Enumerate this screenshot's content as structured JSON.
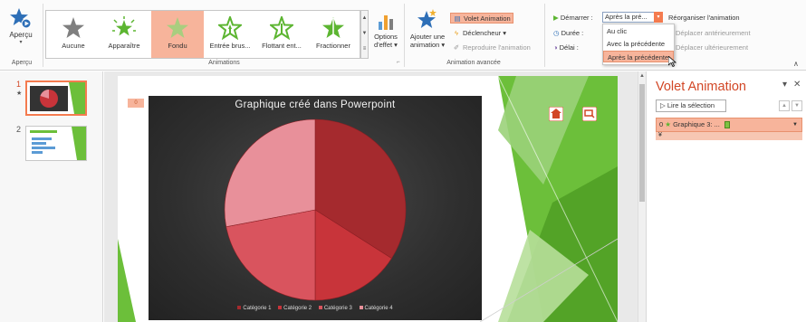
{
  "ribbon": {
    "apercu_button": "Aperçu",
    "apercu_group": "Aperçu",
    "animations_group": "Animations",
    "advanced_group": "Animation avancée",
    "effects": [
      {
        "label": "Aucune",
        "color": "#7f7f7f"
      },
      {
        "label": "Apparaître",
        "color": "#5cb531"
      },
      {
        "label": "Fondu",
        "color": "#5cb531"
      },
      {
        "label": "Entrée brus...",
        "color": "#5cb531"
      },
      {
        "label": "Flottant ent...",
        "color": "#5cb531"
      },
      {
        "label": "Fractionner",
        "color": "#5cb531"
      }
    ],
    "selected_effect": "Fondu",
    "options_label_1": "Options",
    "options_label_2": "d'effet ▾",
    "add_anim_1": "Ajouter une",
    "add_anim_2": "animation ▾",
    "volet_animation": "Volet Animation",
    "declencheur": "Déclencheur ▾",
    "reproduire": "Reproduire l'animation",
    "demarrer_label": "Démarrer :",
    "demarrer_value": "Après la pré...",
    "duree_label": "Durée :",
    "delai_label": "Délai :",
    "dropdown_options": [
      "Au clic",
      "Avec la précédente",
      "Après la précédente"
    ],
    "dropdown_selected": "Après la précédente",
    "reorganiser": "Réorganiser l'animation",
    "deplacer_avant": "Déplacer antérieurement",
    "deplacer_apres": "Déplacer ultérieurement"
  },
  "thumbnails": [
    {
      "number": "1",
      "marker": "★",
      "active": true
    },
    {
      "number": "2",
      "marker": "",
      "active": false
    }
  ],
  "slide": {
    "tag": "0",
    "chart_data": {
      "type": "pie",
      "title": "Graphique créé dans Powerpoint",
      "categories": [
        "Catégorie 1",
        "Catégorie 2",
        "Catégorie 3",
        "Catégorie 4"
      ],
      "values": [
        34,
        16,
        22,
        28
      ],
      "colors": [
        "#a52a2e",
        "#c8343a",
        "#d9545e",
        "#e8909a"
      ],
      "legend_position": "bottom"
    }
  },
  "pane": {
    "title": "Volet Animation",
    "play_button": "Lire la sélection",
    "item_index": "0",
    "item_label": "Graphique 3: ...",
    "expand": "¥"
  },
  "colors": {
    "accent": "#d24726",
    "highlight": "#f7b49b",
    "green": "#5cb531"
  }
}
